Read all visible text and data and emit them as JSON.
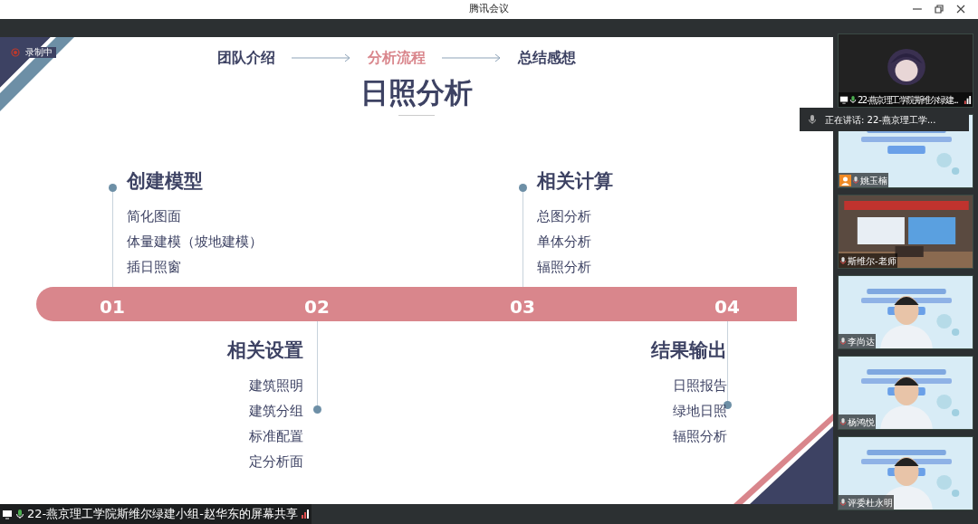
{
  "window": {
    "title": "腾讯会议"
  },
  "recording": {
    "label": "录制中"
  },
  "slide": {
    "nav": [
      {
        "label": "团队介绍",
        "selected": false
      },
      {
        "label": "分析流程",
        "selected": true
      },
      {
        "label": "总结感想",
        "selected": false
      }
    ],
    "title": "日照分析",
    "steps": [
      {
        "number": "01",
        "heading": "创建模型",
        "kind": "above",
        "items": [
          "简化图面",
          "体量建模（坡地建模）",
          "插日照窗"
        ]
      },
      {
        "number": "02",
        "heading": "相关设置",
        "kind": "below",
        "items": [
          "建筑照明",
          "建筑分组",
          "标准配置",
          "定分析面"
        ]
      },
      {
        "number": "03",
        "heading": "相关计算",
        "kind": "above",
        "items": [
          "总图分析",
          "单体分析",
          "辐照分析"
        ]
      },
      {
        "number": "04",
        "heading": "结果输出",
        "kind": "below",
        "items": [
          "日照报告",
          "绿地日照",
          "辐照分析"
        ]
      }
    ]
  },
  "speaking_tooltip": {
    "text": "正在讲话: 22-燕京理工学..."
  },
  "participants": [
    {
      "name": "22-燕京理工学院斯维尔绿建...",
      "kind": "avatar",
      "sharing": true
    },
    {
      "name": "姚玉楠",
      "kind": "slide",
      "sharing": false
    },
    {
      "name": "斯维尔-老师",
      "kind": "room",
      "sharing": false
    },
    {
      "name": "李尚达",
      "kind": "person",
      "sharing": false
    },
    {
      "name": "杨鸿悦",
      "kind": "person",
      "sharing": false
    },
    {
      "name": "评委杜永明",
      "kind": "person",
      "sharing": false
    }
  ],
  "status_bar": {
    "text": "22-燕京理工学院斯维尔绿建小组-赵华东的屏幕共享"
  }
}
